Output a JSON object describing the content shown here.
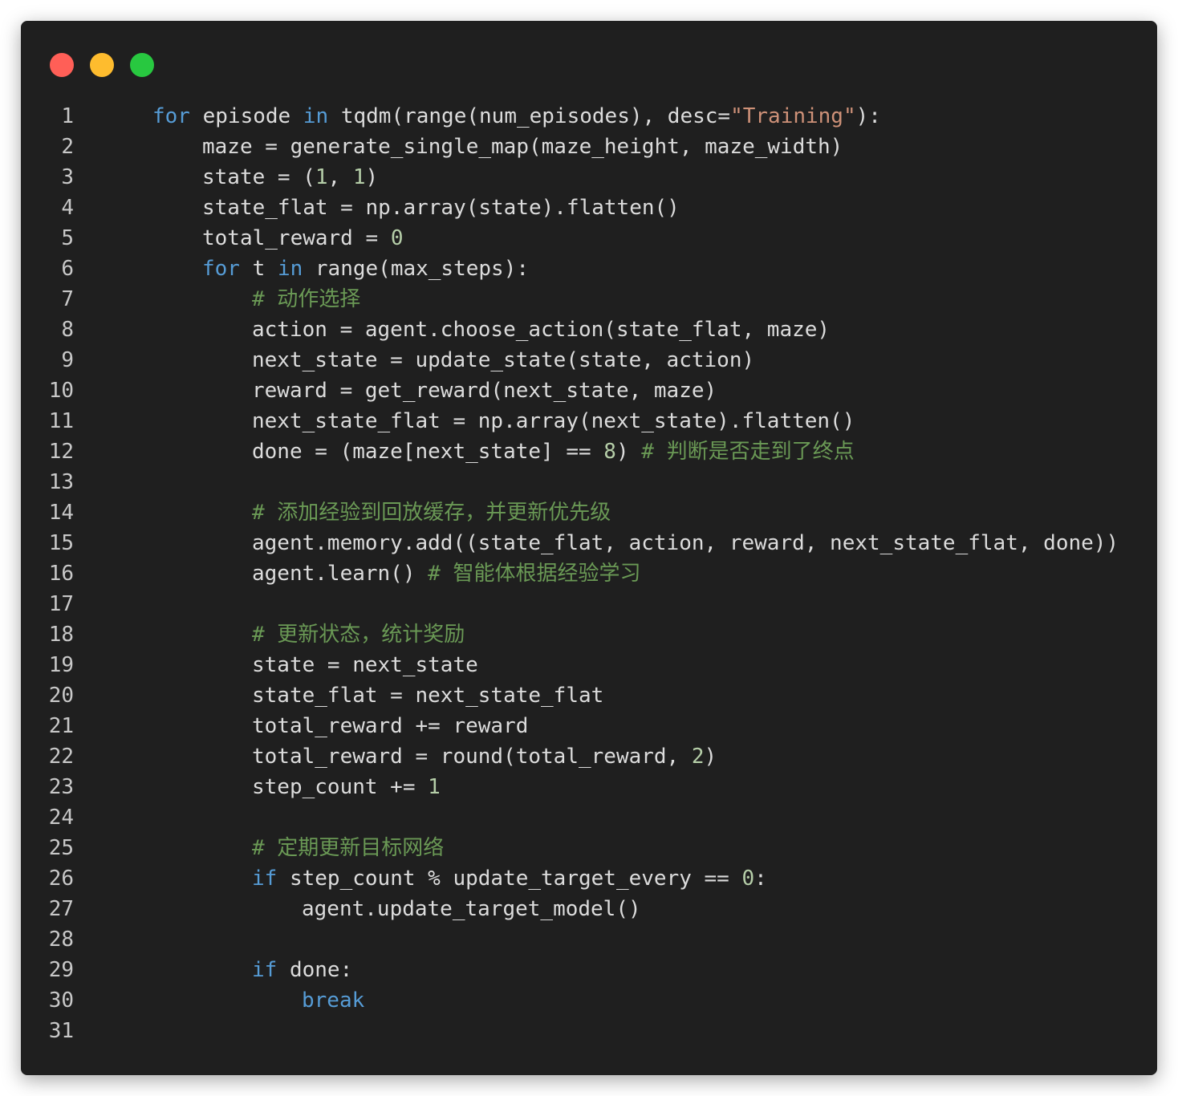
{
  "window": {
    "buttons": [
      {
        "name": "close-button",
        "color": "#ff5f57"
      },
      {
        "name": "minimize-button",
        "color": "#febc2e"
      },
      {
        "name": "maximize-button",
        "color": "#28c840"
      }
    ]
  },
  "theme": {
    "keyword": "#569cd6",
    "string": "#ce9178",
    "number": "#b5cea8",
    "comment": "#6a9955",
    "text": "#dcdcdc",
    "background": "#1f1f1f"
  },
  "code": {
    "lines": [
      {
        "n": "1",
        "indent": 0,
        "tokens": [
          [
            "kw",
            "for"
          ],
          [
            "t",
            " episode "
          ],
          [
            "kw",
            "in"
          ],
          [
            "t",
            " tqdm(range(num_episodes), desc="
          ],
          [
            "s",
            "\"Training\""
          ],
          [
            "t",
            "):"
          ]
        ]
      },
      {
        "n": "2",
        "indent": 1,
        "tokens": [
          [
            "t",
            "maze = generate_single_map(maze_height, maze_width)"
          ]
        ]
      },
      {
        "n": "3",
        "indent": 1,
        "tokens": [
          [
            "t",
            "state = ("
          ],
          [
            "num",
            "1"
          ],
          [
            "t",
            ", "
          ],
          [
            "num",
            "1"
          ],
          [
            "t",
            ")"
          ]
        ]
      },
      {
        "n": "4",
        "indent": 1,
        "tokens": [
          [
            "t",
            "state_flat = np.array(state).flatten()"
          ]
        ]
      },
      {
        "n": "5",
        "indent": 1,
        "tokens": [
          [
            "t",
            "total_reward = "
          ],
          [
            "num",
            "0"
          ]
        ]
      },
      {
        "n": "6",
        "indent": 1,
        "tokens": [
          [
            "kw",
            "for"
          ],
          [
            "t",
            " t "
          ],
          [
            "kw",
            "in"
          ],
          [
            "t",
            " range(max_steps):"
          ]
        ]
      },
      {
        "n": "7",
        "indent": 2,
        "tokens": [
          [
            "c",
            "# 动作选择"
          ]
        ]
      },
      {
        "n": "8",
        "indent": 2,
        "tokens": [
          [
            "t",
            "action = agent.choose_action(state_flat, maze)"
          ]
        ]
      },
      {
        "n": "9",
        "indent": 2,
        "tokens": [
          [
            "t",
            "next_state = update_state(state, action)"
          ]
        ]
      },
      {
        "n": "10",
        "indent": 2,
        "tokens": [
          [
            "t",
            "reward = get_reward(next_state, maze)"
          ]
        ]
      },
      {
        "n": "11",
        "indent": 2,
        "tokens": [
          [
            "t",
            "next_state_flat = np.array(next_state).flatten()"
          ]
        ]
      },
      {
        "n": "12",
        "indent": 2,
        "tokens": [
          [
            "t",
            "done = (maze[next_state] == "
          ],
          [
            "num",
            "8"
          ],
          [
            "t",
            ") "
          ],
          [
            "c",
            "# 判断是否走到了终点"
          ]
        ]
      },
      {
        "n": "13",
        "indent": 0,
        "tokens": []
      },
      {
        "n": "14",
        "indent": 2,
        "tokens": [
          [
            "c",
            "# 添加经验到回放缓存，并更新优先级"
          ]
        ]
      },
      {
        "n": "15",
        "indent": 2,
        "tokens": [
          [
            "t",
            "agent.memory.add((state_flat, action, reward, next_state_flat, done))"
          ]
        ]
      },
      {
        "n": "16",
        "indent": 2,
        "tokens": [
          [
            "t",
            "agent.learn() "
          ],
          [
            "c",
            "# 智能体根据经验学习"
          ]
        ]
      },
      {
        "n": "17",
        "indent": 0,
        "tokens": []
      },
      {
        "n": "18",
        "indent": 2,
        "tokens": [
          [
            "c",
            "# 更新状态，统计奖励"
          ]
        ]
      },
      {
        "n": "19",
        "indent": 2,
        "tokens": [
          [
            "t",
            "state = next_state"
          ]
        ]
      },
      {
        "n": "20",
        "indent": 2,
        "tokens": [
          [
            "t",
            "state_flat = next_state_flat"
          ]
        ]
      },
      {
        "n": "21",
        "indent": 2,
        "tokens": [
          [
            "t",
            "total_reward += reward"
          ]
        ]
      },
      {
        "n": "22",
        "indent": 2,
        "tokens": [
          [
            "t",
            "total_reward = round(total_reward, "
          ],
          [
            "num",
            "2"
          ],
          [
            "t",
            ")"
          ]
        ]
      },
      {
        "n": "23",
        "indent": 2,
        "tokens": [
          [
            "t",
            "step_count += "
          ],
          [
            "num",
            "1"
          ]
        ]
      },
      {
        "n": "24",
        "indent": 0,
        "tokens": []
      },
      {
        "n": "25",
        "indent": 2,
        "tokens": [
          [
            "c",
            "# 定期更新目标网络"
          ]
        ]
      },
      {
        "n": "26",
        "indent": 2,
        "tokens": [
          [
            "kw",
            "if"
          ],
          [
            "t",
            " step_count % update_target_every == "
          ],
          [
            "num",
            "0"
          ],
          [
            "t",
            ":"
          ]
        ]
      },
      {
        "n": "27",
        "indent": 3,
        "tokens": [
          [
            "t",
            "agent.update_target_model()"
          ]
        ]
      },
      {
        "n": "28",
        "indent": 0,
        "tokens": []
      },
      {
        "n": "29",
        "indent": 2,
        "tokens": [
          [
            "kw",
            "if"
          ],
          [
            "t",
            " done:"
          ]
        ]
      },
      {
        "n": "30",
        "indent": 3,
        "tokens": [
          [
            "kw",
            "break"
          ]
        ]
      },
      {
        "n": "31",
        "indent": 0,
        "tokens": []
      }
    ]
  }
}
